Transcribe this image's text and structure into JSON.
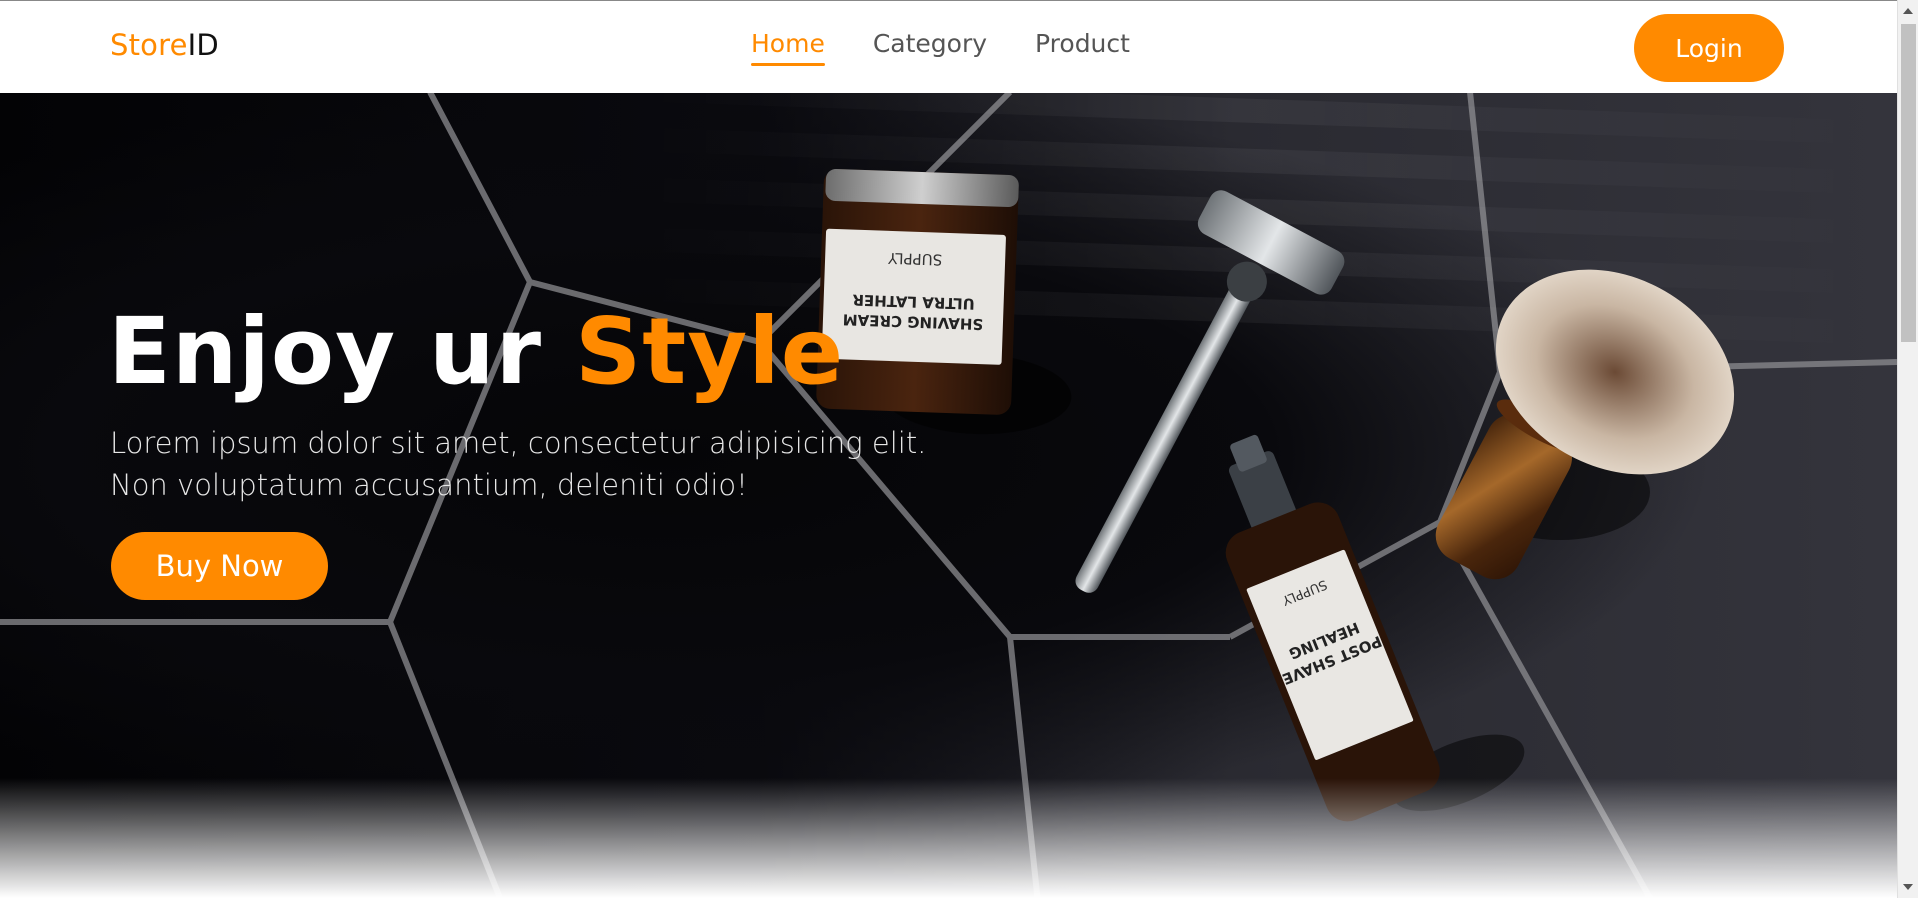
{
  "brand": {
    "accent": "Store",
    "rest": "ID",
    "accent_color": "#ff8a00"
  },
  "nav": {
    "items": [
      {
        "label": "Home",
        "active": true
      },
      {
        "label": "Category",
        "active": false
      },
      {
        "label": "Product",
        "active": false
      }
    ]
  },
  "header": {
    "login_label": "Login"
  },
  "hero": {
    "title_main": "Enjoy ur ",
    "title_accent": "Style",
    "description_line1": "Lorem ipsum dolor sit amet, consectetur adipisicing elit.",
    "description_line2": "Non voluptatum accusantium, deleniti odio!",
    "cta_label": "Buy Now",
    "jar_label": {
      "brand": "SUPPLY",
      "line1": "ULTRA LATHER",
      "line2": "SHAVING CREAM"
    },
    "bottle_label": {
      "brand": "SUPPLY",
      "line1": "HEALING",
      "line2": "POST SHAVE"
    }
  },
  "colors": {
    "accent": "#ff8a00",
    "hero_bg": "#0a0a0f",
    "nav_text": "#555555"
  }
}
